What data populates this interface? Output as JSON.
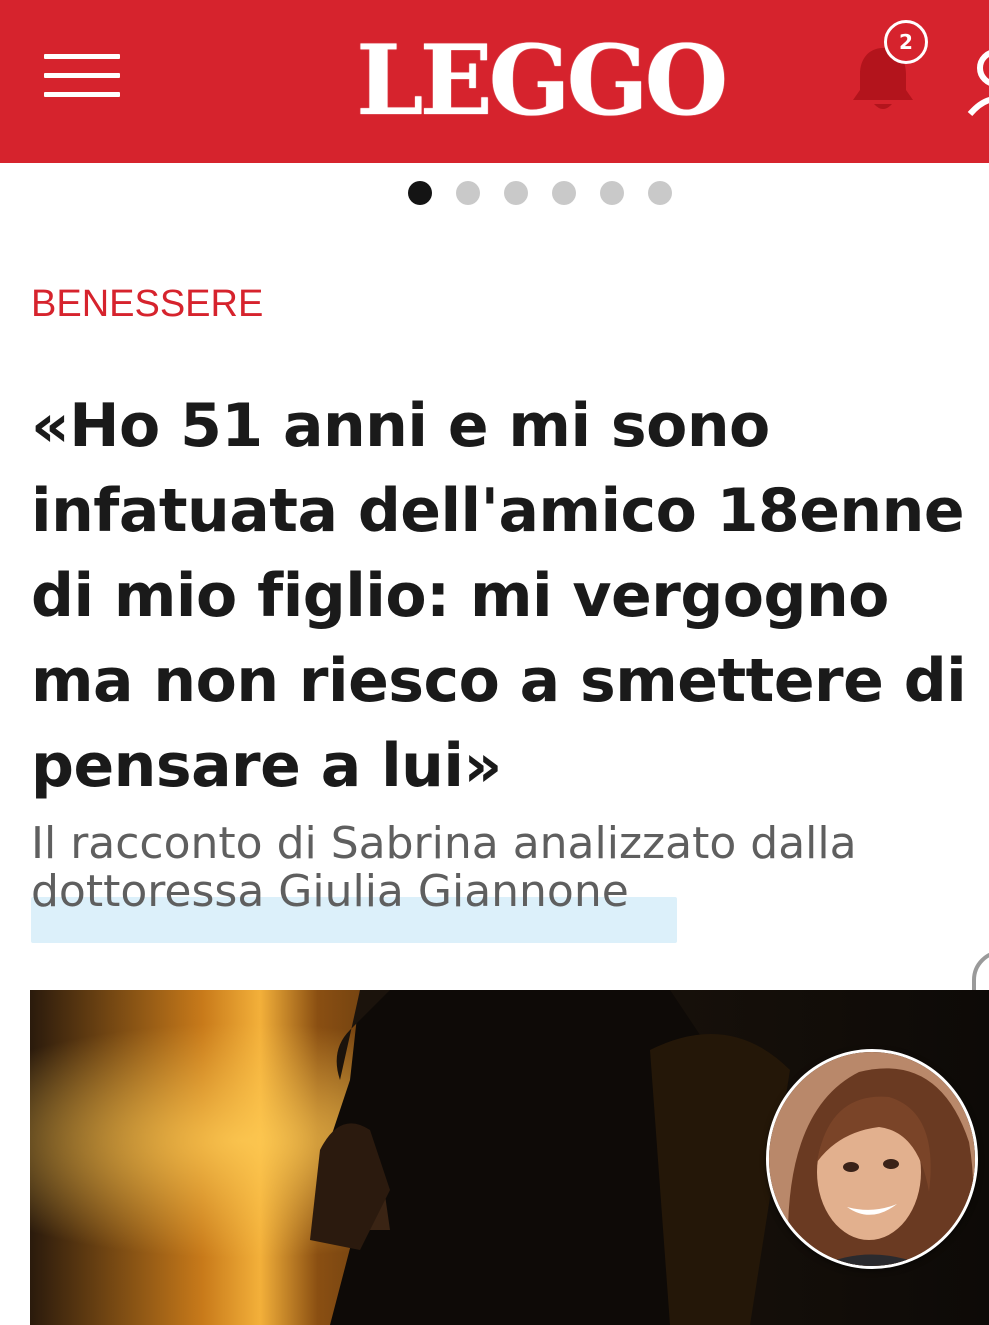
{
  "header": {
    "logo_text": "LEGGO",
    "notification_count": "2",
    "brand_color": "#d6232d",
    "icons": [
      "hamburger-menu-icon",
      "bell-icon",
      "user-icon"
    ]
  },
  "carousel": {
    "page_count": 6,
    "active_index": 0
  },
  "article": {
    "section": "BENESSERE",
    "title": "«Ho 51 anni e mi sono\ninfatuata dell'amico 18enne\ndi mio figlio: mi vergogno\nma non riesco a smettere di\npensare a lui»",
    "subtitle": "Il racconto di Sabrina analizzato dalla\ndottoressa Giulia Giannone"
  }
}
